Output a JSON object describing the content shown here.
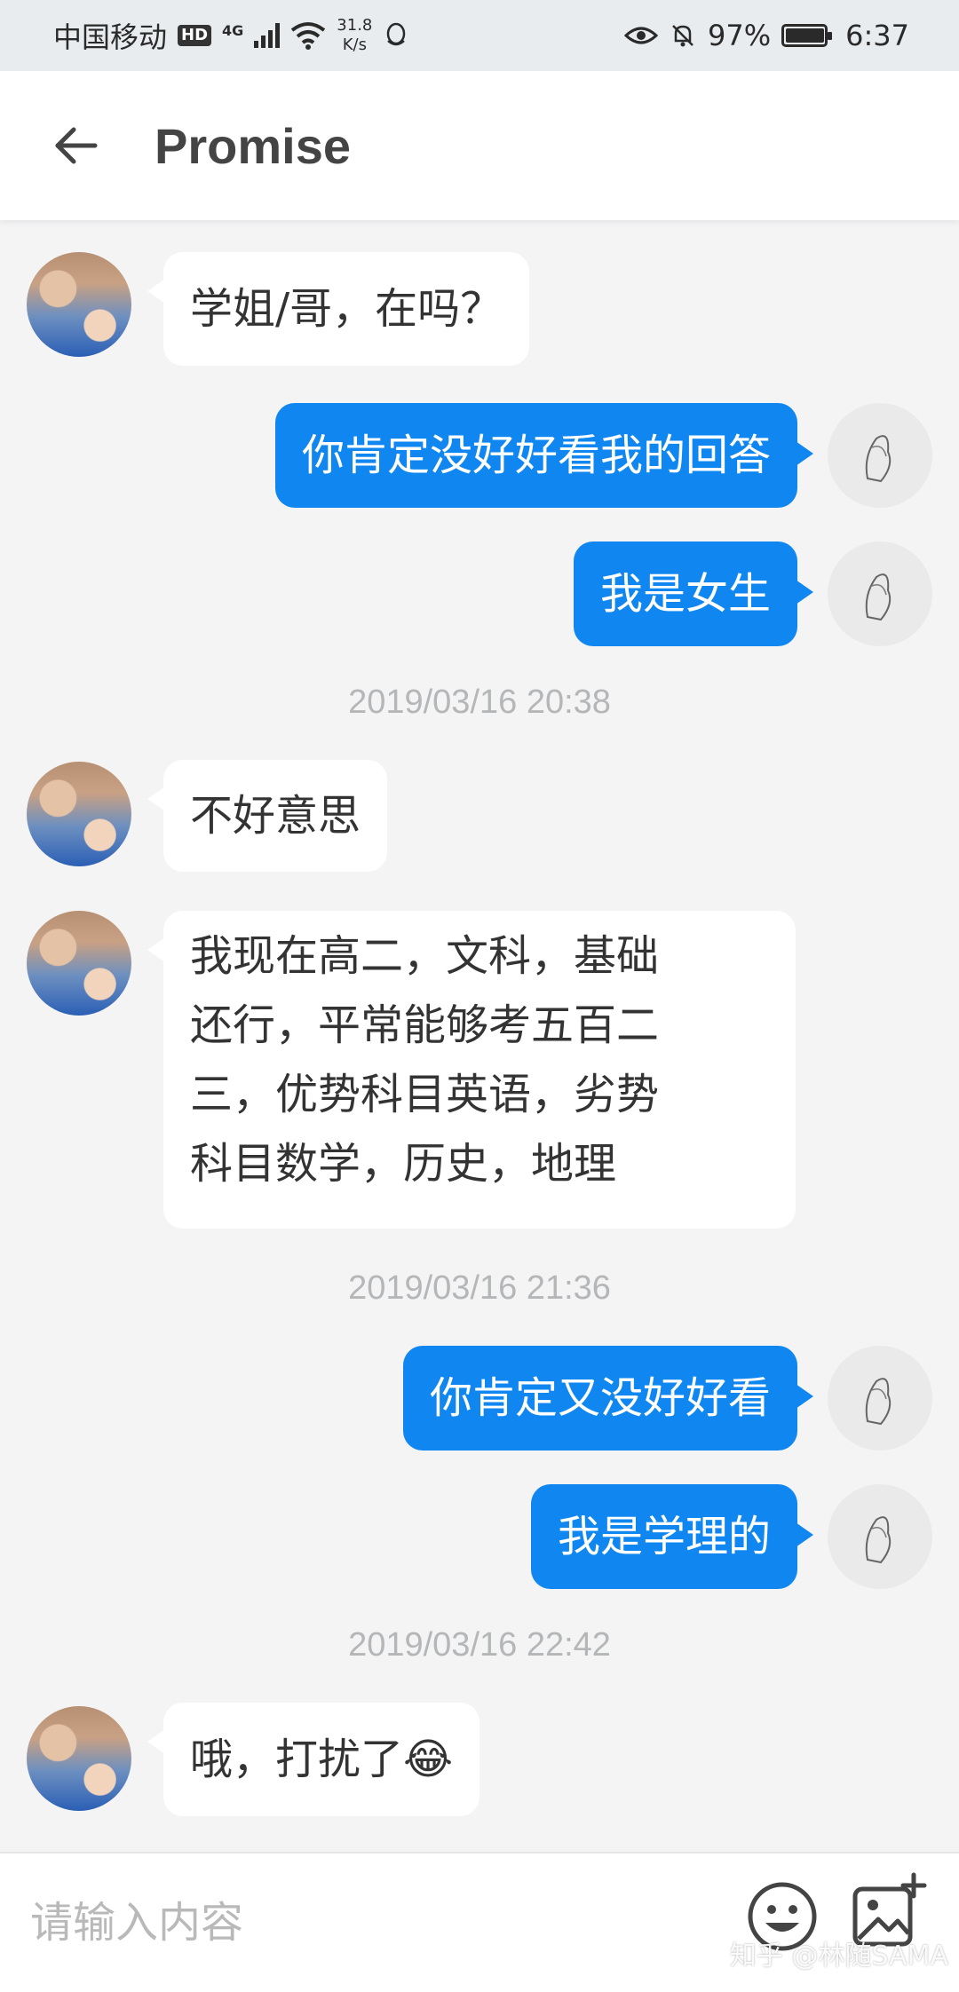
{
  "status_bar": {
    "carrier": "中国移动",
    "hd": "HD",
    "network": "4G",
    "speed_value": "31.8",
    "speed_unit": "K/s",
    "battery": "97%",
    "time": "6:37"
  },
  "header": {
    "title": "Promise",
    "back_icon": "arrow-left-icon"
  },
  "messages": [
    {
      "side": "in",
      "text": "学姐/哥，在吗？"
    },
    {
      "side": "out",
      "text": "你肯定没好好看我的回答"
    },
    {
      "side": "out",
      "text": "我是女生"
    },
    {
      "type": "timestamp",
      "text": "2019/03/16 20:38"
    },
    {
      "side": "in",
      "text": "不好意思"
    },
    {
      "side": "in",
      "lines": [
        "我现在高二，文科，基础",
        "还行，平常能够考五百二",
        "三，优势科目英语，劣势",
        "科目数学，历史，地理"
      ]
    },
    {
      "type": "timestamp",
      "text": "2019/03/16 21:36"
    },
    {
      "side": "out",
      "text": "你肯定又没好好看"
    },
    {
      "side": "out",
      "text": "我是学理的"
    },
    {
      "type": "timestamp",
      "text": "2019/03/16 22:42"
    },
    {
      "side": "in",
      "text": "哦，打扰了",
      "emoji": "😂"
    }
  ],
  "input": {
    "placeholder": "请输入内容",
    "emoji_icon": "emoji-face-icon",
    "image_icon": "add-image-icon"
  },
  "watermark": "知乎 @林随SAMA",
  "colors": {
    "outgoing_bubble": "#0f86f0",
    "incoming_bubble": "#ffffff",
    "background": "#f4f4f5",
    "timestamp": "#b4b6b8"
  }
}
